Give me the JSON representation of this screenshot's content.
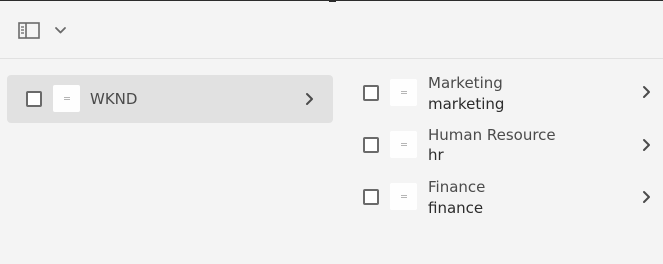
{
  "toolbar": {
    "rail_icon": "panel-left-icon",
    "dropdown_icon": "chevron-down-icon"
  },
  "column_one": {
    "items": [
      {
        "label": "WKND",
        "selected": true
      }
    ]
  },
  "column_two": {
    "items": [
      {
        "title": "Marketing",
        "name": "marketing"
      },
      {
        "title": "Human Resource",
        "name": "hr"
      },
      {
        "title": "Finance",
        "name": "finance"
      }
    ]
  },
  "colors": {
    "background": "#f4f4f4",
    "selected_row": "#e1e1e1",
    "text": "#4b4b4b"
  }
}
